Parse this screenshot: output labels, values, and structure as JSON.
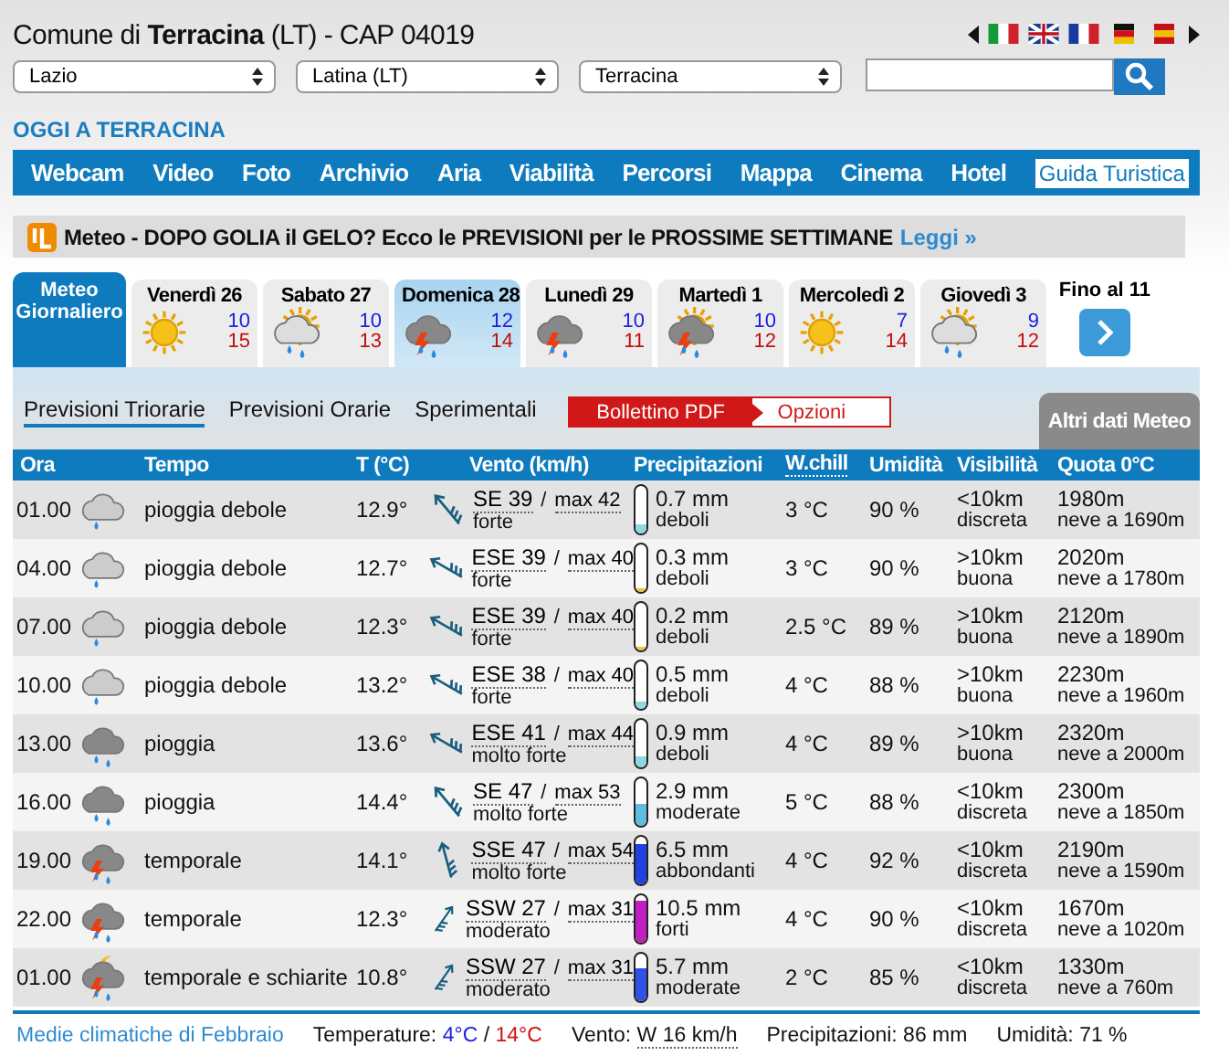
{
  "header": {
    "title": "Comune di **Terracina** (LT) - CAP 04019",
    "selects": [
      "Lazio",
      "Latina (LT)",
      "Terracina"
    ]
  },
  "section_title": "OGGI A TERRACINA",
  "nav": {
    "items": [
      "Webcam",
      "Video",
      "Foto",
      "Archivio",
      "Aria",
      "Viabilità",
      "Percorsi",
      "Mappa",
      "Cinema",
      "Hotel"
    ],
    "guide": "Guida Turistica"
  },
  "banner": {
    "text": "Meteo - DOPO GOLIA il GELO? Ecco le PREVISIONI per le PROSSIME SETTIMANE",
    "link": "Leggi »"
  },
  "day_tabs": {
    "main": "Meteo Giornaliero",
    "days": [
      {
        "name": "Venerdì 26",
        "kind": "sun",
        "min": "10",
        "max": "15",
        "selected": false
      },
      {
        "name": "Sabato 27",
        "kind": "sun-rain",
        "min": "10",
        "max": "13",
        "selected": false
      },
      {
        "name": "Domenica 28",
        "kind": "storm",
        "min": "12",
        "max": "14",
        "selected": true
      },
      {
        "name": "Lunedì 29",
        "kind": "storm",
        "min": "10",
        "max": "11",
        "selected": false
      },
      {
        "name": "Martedì 1",
        "kind": "sun-storm",
        "min": "10",
        "max": "12",
        "selected": false
      },
      {
        "name": "Mercoledì 2",
        "kind": "sun",
        "min": "7",
        "max": "14",
        "selected": false
      },
      {
        "name": "Giovedì 3",
        "kind": "sun-rain",
        "min": "9",
        "max": "12",
        "selected": false
      }
    ],
    "more": "Fino al 11"
  },
  "subtabs": [
    {
      "label": "Previsioni Triorarie",
      "selected": true
    },
    {
      "label": "Previsioni Orarie",
      "selected": false
    },
    {
      "label": "Sperimentali",
      "selected": false
    }
  ],
  "pdf_button": "Bollettino PDF",
  "options_button": "Opzioni",
  "other_data_tab": "Altri dati Meteo",
  "table": {
    "columns": [
      "Ora",
      "Tempo",
      "T (°C)",
      "Vento (km/h)",
      "Precipitazioni",
      "W.chill",
      "Umidità",
      "Visibilità",
      "Quota 0°C"
    ],
    "separator": "/",
    "rows": [
      {
        "time": "01.00",
        "kind": "light-rain",
        "weather": "pioggia debole",
        "temp": "12.9°",
        "wind": {
          "kind": "nw",
          "speed": "SE 39",
          "max": "max 42",
          "strength": "forte"
        },
        "precip": {
          "amount": "0.7 mm",
          "label": "deboli",
          "level": 0.2,
          "color": "#8fd8e0"
        },
        "wind_chill": "3 °C",
        "humidity": "90 %",
        "visibility": "<10km",
        "visibility_label": "discreta",
        "freezing": "1980m",
        "snow": "neve a 1690m"
      },
      {
        "time": "04.00",
        "kind": "light-rain",
        "weather": "pioggia debole",
        "temp": "12.7°",
        "wind": {
          "kind": "wnw",
          "speed": "ESE 39",
          "max": "max 40",
          "strength": "forte"
        },
        "precip": {
          "amount": "0.3 mm",
          "label": "deboli",
          "level": 0.08,
          "color": "#e8c840"
        },
        "wind_chill": "3 °C",
        "humidity": "90 %",
        "visibility": ">10km",
        "visibility_label": "buona",
        "freezing": "2020m",
        "snow": "neve a 1780m"
      },
      {
        "time": "07.00",
        "kind": "light-rain",
        "weather": "pioggia debole",
        "temp": "12.3°",
        "wind": {
          "kind": "wnw",
          "speed": "ESE 39",
          "max": "max 40",
          "strength": "forte"
        },
        "precip": {
          "amount": "0.2 mm",
          "label": "deboli",
          "level": 0.06,
          "color": "#e8c840"
        },
        "wind_chill": "2.5 °C",
        "humidity": "89 %",
        "visibility": ">10km",
        "visibility_label": "buona",
        "freezing": "2120m",
        "snow": "neve a 1890m"
      },
      {
        "time": "10.00",
        "kind": "light-rain",
        "weather": "pioggia debole",
        "temp": "13.2°",
        "wind": {
          "kind": "wnw",
          "speed": "ESE 38",
          "max": "max 40",
          "strength": "forte"
        },
        "precip": {
          "amount": "0.5 mm",
          "label": "deboli",
          "level": 0.15,
          "color": "#8fd8e0"
        },
        "wind_chill": "4 °C",
        "humidity": "88 %",
        "visibility": ">10km",
        "visibility_label": "buona",
        "freezing": "2230m",
        "snow": "neve a 1960m"
      },
      {
        "time": "13.00",
        "kind": "rain",
        "weather": "pioggia",
        "temp": "13.6°",
        "wind": {
          "kind": "wnw",
          "speed": "ESE 41",
          "max": "max 44",
          "strength": "molto forte"
        },
        "precip": {
          "amount": "0.9 mm",
          "label": "deboli",
          "level": 0.25,
          "color": "#8fd8e0"
        },
        "wind_chill": "4 °C",
        "humidity": "89 %",
        "visibility": ">10km",
        "visibility_label": "buona",
        "freezing": "2320m",
        "snow": "neve a 2000m"
      },
      {
        "time": "16.00",
        "kind": "rain",
        "weather": "pioggia",
        "temp": "14.4°",
        "wind": {
          "kind": "nw",
          "speed": "SE 47",
          "max": "max 53",
          "strength": "molto forte"
        },
        "precip": {
          "amount": "2.9 mm",
          "label": "moderate",
          "level": 0.45,
          "color": "#60bce0"
        },
        "wind_chill": "5 °C",
        "humidity": "88 %",
        "visibility": "<10km",
        "visibility_label": "discreta",
        "freezing": "2300m",
        "snow": "neve a 1850m"
      },
      {
        "time": "19.00",
        "kind": "storm",
        "weather": "temporale",
        "temp": "14.1°",
        "wind": {
          "kind": "n",
          "speed": "SSE 47",
          "max": "max 54",
          "strength": "molto forte"
        },
        "precip": {
          "amount": "6.5 mm",
          "label": "abbondanti",
          "level": 0.85,
          "color": "#2040e0"
        },
        "wind_chill": "4 °C",
        "humidity": "92 %",
        "visibility": "<10km",
        "visibility_label": "discreta",
        "freezing": "2190m",
        "snow": "neve a 1590m"
      },
      {
        "time": "22.00",
        "kind": "storm",
        "weather": "temporale",
        "temp": "12.3°",
        "wind": {
          "kind": "ne",
          "speed": "SSW 27",
          "max": "max 31",
          "strength": "moderato"
        },
        "precip": {
          "amount": "10.5 mm",
          "label": "forti",
          "level": 0.9,
          "color": "#c020c0"
        },
        "wind_chill": "4 °C",
        "humidity": "90 %",
        "visibility": "<10km",
        "visibility_label": "discreta",
        "freezing": "1670m",
        "snow": "neve a 1020m"
      },
      {
        "time": "01.00",
        "kind": "moon-storm",
        "weather": "temporale e schiarite",
        "temp": "10.8°",
        "wind": {
          "kind": "ne",
          "speed": "SSW 27",
          "max": "max 31",
          "strength": "moderato"
        },
        "precip": {
          "amount": "5.7 mm",
          "label": "moderate",
          "level": 0.7,
          "color": "#3050e8"
        },
        "wind_chill": "2 °C",
        "humidity": "85 %",
        "visibility": "<10km",
        "visibility_label": "discreta",
        "freezing": "1330m",
        "snow": "neve a 760m"
      }
    ]
  },
  "footer": {
    "link": "Medie climatiche di Febbraio",
    "temp_label": "Temperature:",
    "temp_min": "4°C",
    "temp_sep": "/",
    "temp_max": "14°C",
    "wind_label": "Vento:",
    "wind_value": "W 16 km/h",
    "precip": "Precipitazioni: 86 mm",
    "humidity": "Umidità: 71 %"
  }
}
